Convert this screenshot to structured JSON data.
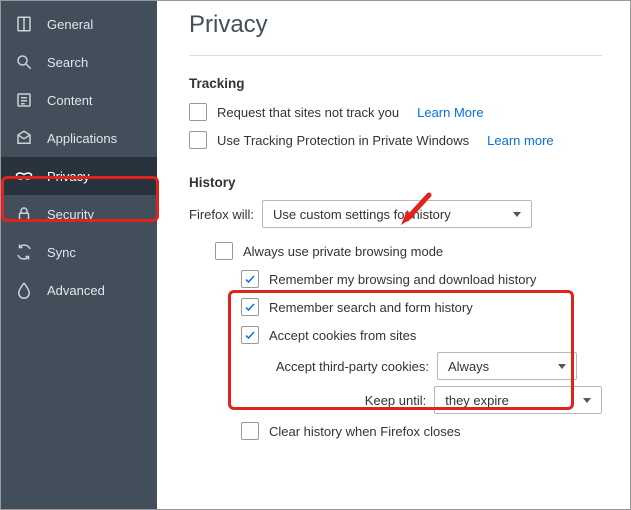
{
  "sidebar": {
    "items": [
      {
        "label": "General"
      },
      {
        "label": "Search"
      },
      {
        "label": "Content"
      },
      {
        "label": "Applications"
      },
      {
        "label": "Privacy"
      },
      {
        "label": "Security"
      },
      {
        "label": "Sync"
      },
      {
        "label": "Advanced"
      }
    ]
  },
  "page": {
    "title": "Privacy"
  },
  "tracking": {
    "heading": "Tracking",
    "dnt_label": "Request that sites not track you",
    "dnt_learn": "Learn More",
    "tp_label": "Use Tracking Protection in Private Windows",
    "tp_learn": "Learn more"
  },
  "history": {
    "heading": "History",
    "will_label": "Firefox will:",
    "will_value": "Use custom settings for history",
    "always_private": "Always use private browsing mode",
    "remember_browsing": "Remember my browsing and download history",
    "remember_search": "Remember search and form history",
    "accept_cookies": "Accept cookies from sites",
    "third_party_label": "Accept third-party cookies:",
    "third_party_value": "Always",
    "keep_until_label": "Keep until:",
    "keep_until_value": "they expire",
    "clear_on_close": "Clear history when Firefox closes"
  }
}
